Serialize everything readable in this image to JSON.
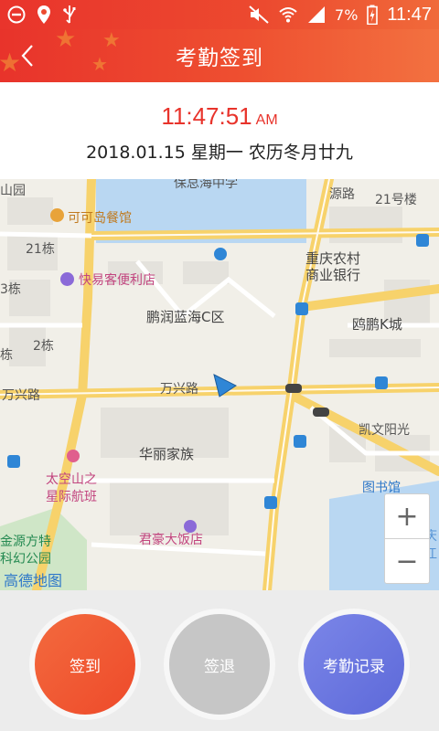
{
  "status_bar": {
    "time": "11:47",
    "battery": "7%"
  },
  "header": {
    "title": "考勤签到"
  },
  "clock": {
    "time": "11:47:51",
    "ampm": "AM",
    "date": "2018.01.15 星期一 农历冬月廿九"
  },
  "map": {
    "labels": {
      "restaurant": "可可岛餐馆",
      "hotel_kuaiyi": "快易客便利店",
      "complex": "鹏润蓝海C区",
      "bank": "重庆农村\n商业银行",
      "oupeng": "鸥鹏K城",
      "road_wanxing": "万兴路",
      "road_wanxing_left": "万兴路",
      "kaiwen": "凯文阳光",
      "huali": "华丽家族",
      "space": "太空山之\n星际航班",
      "library": "图书馆",
      "junhao": "君豪大饭店",
      "park": "金源方特\n科幻公园",
      "road_yuan": "源路",
      "bldg21": "21号楼",
      "dong21": "21栋",
      "dong2": "2栋",
      "dong3": "3栋",
      "dong_left": "栋",
      "yuan": "山园",
      "chong": "重庆",
      "xuejiang": "学江",
      "top_cut": "保总海中学",
      "attribution": "高德地图"
    },
    "zoom_in": "+",
    "zoom_out": "−"
  },
  "actions": {
    "sign_in": "签到",
    "sign_out": "签退",
    "records": "考勤记录"
  },
  "colors": {
    "accent": "#e8332b",
    "sign_in": "#f0553a",
    "sign_out": "#c6c6c6",
    "records": "#6a75e0"
  }
}
